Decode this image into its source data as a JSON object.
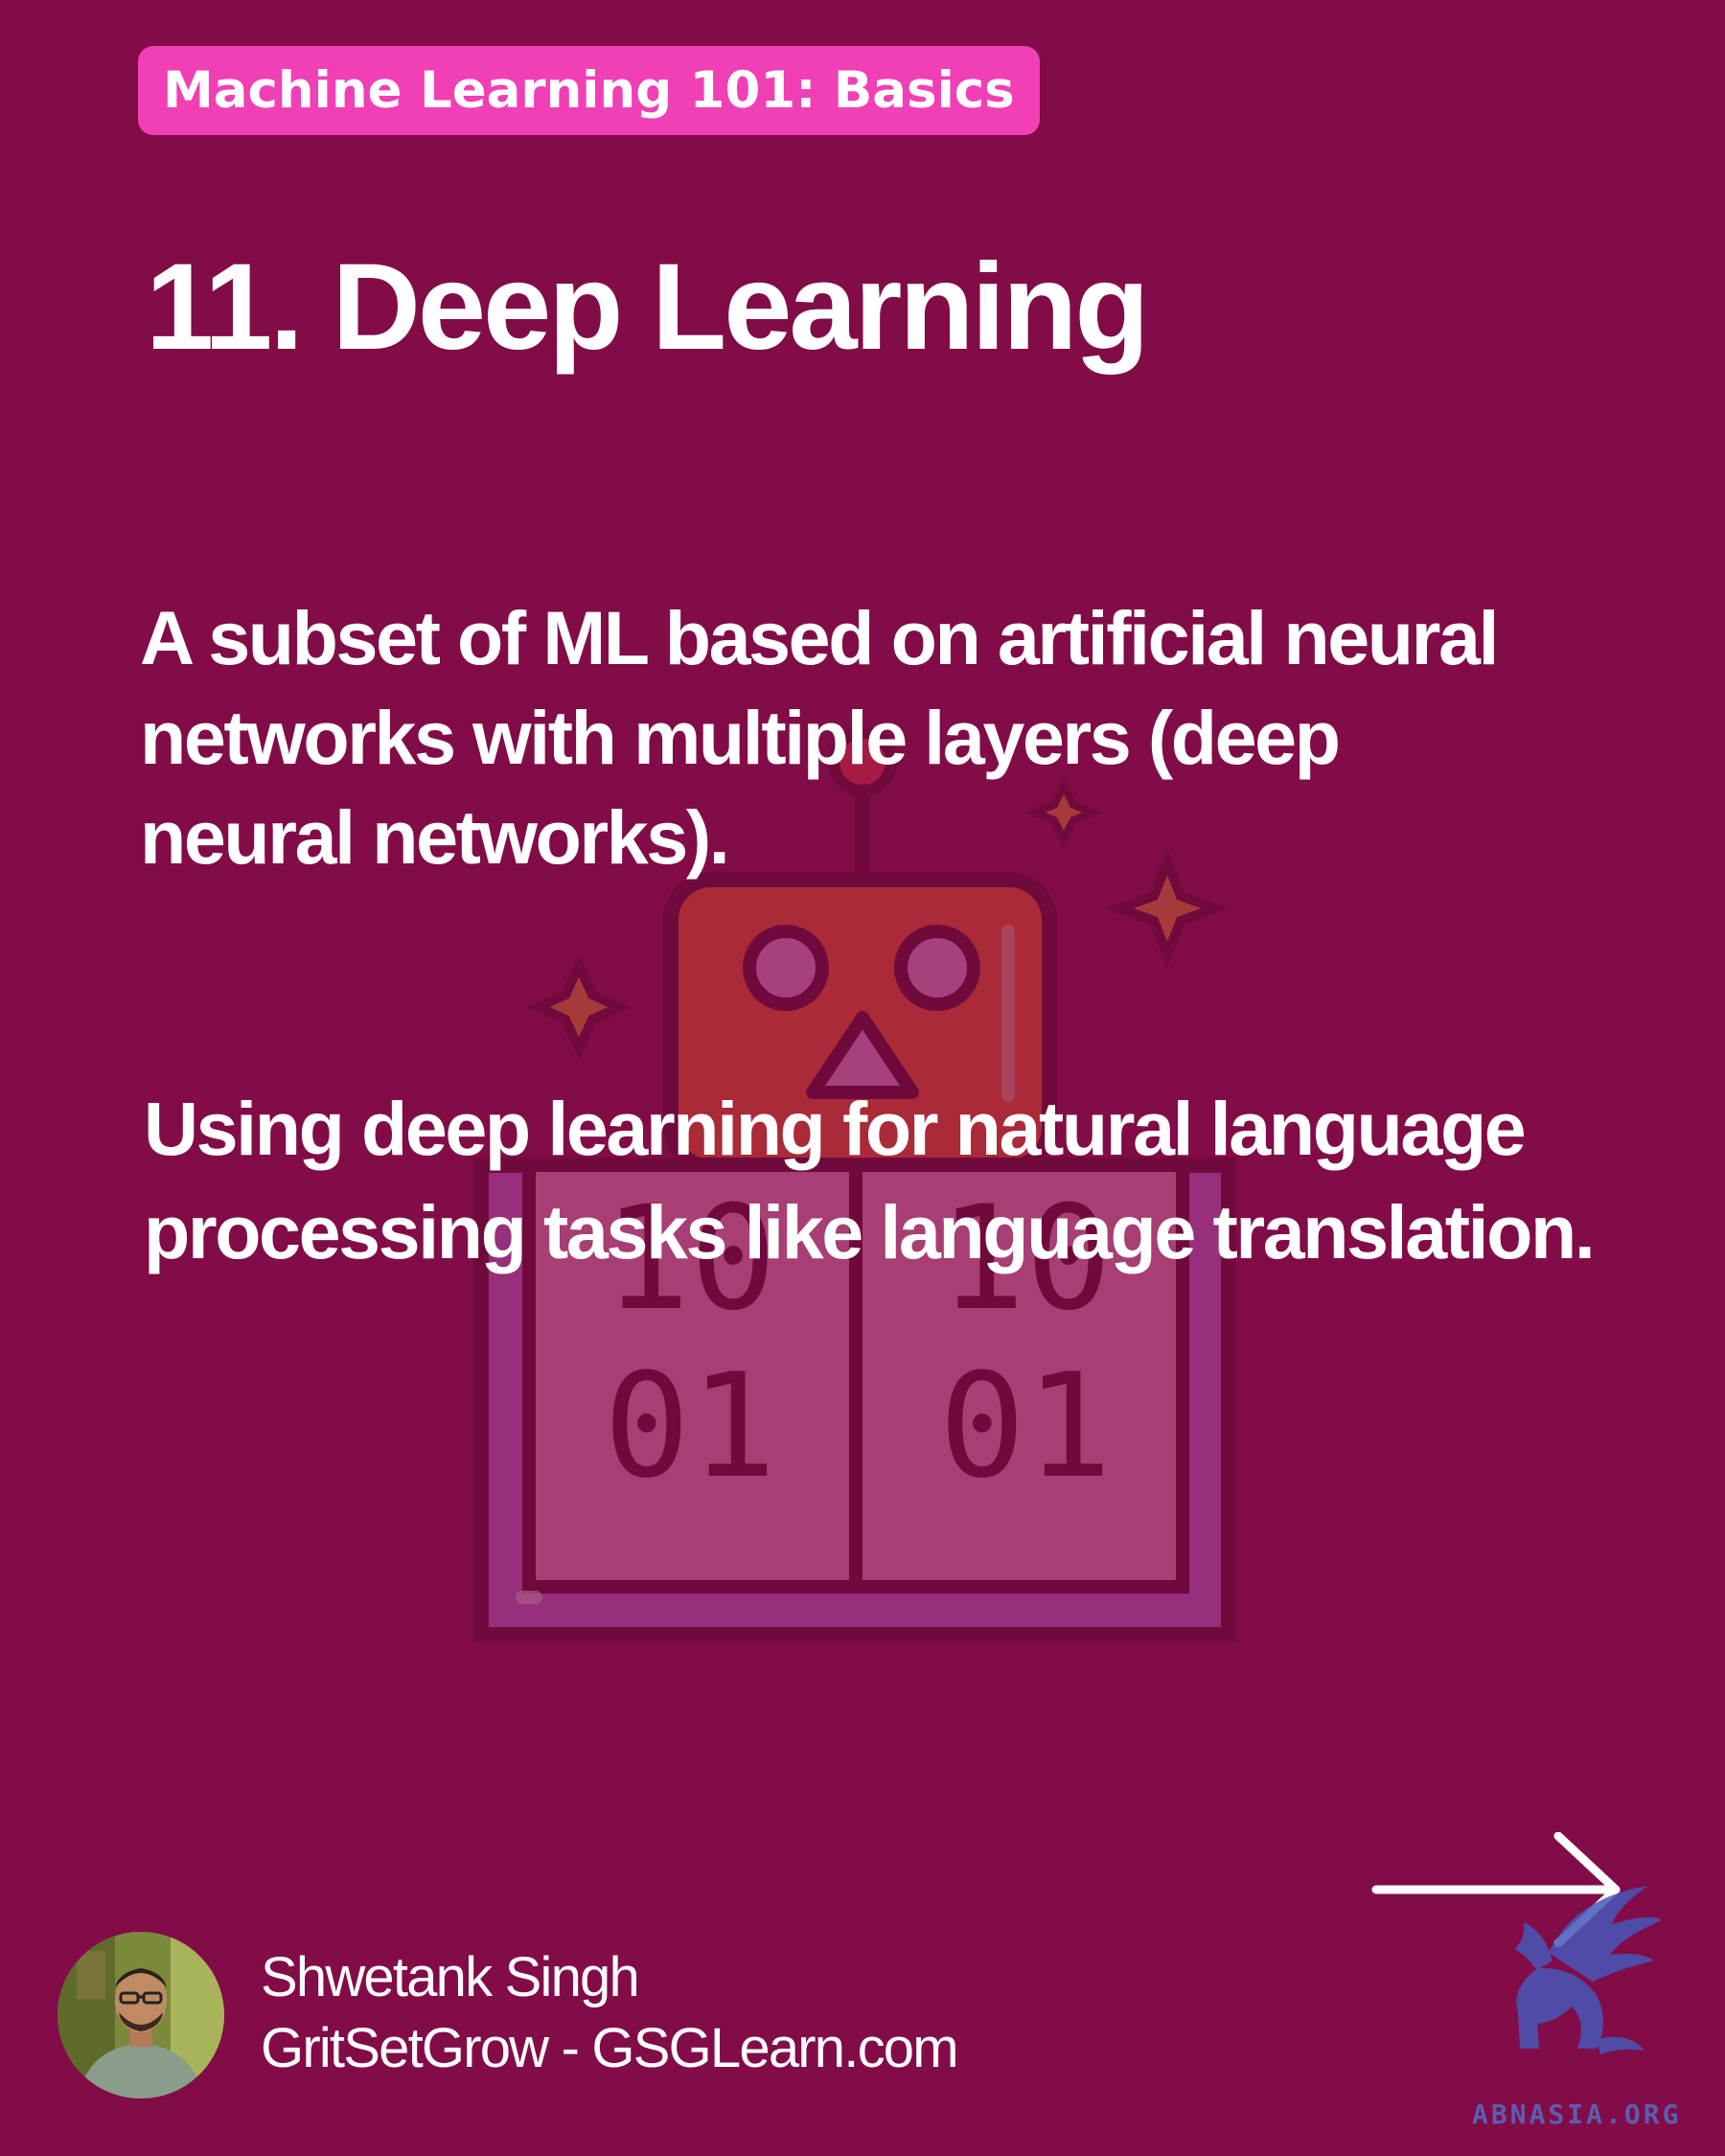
{
  "header": {
    "series_label": "Machine Learning 101: Basics",
    "title": "11. Deep Learning"
  },
  "content": {
    "definition_lines": [
      "A subset of ML based on artificial neural",
      "networks with multiple layers (deep",
      "neural networks)."
    ],
    "example_lines": [
      "Using deep learning for natural language",
      "processing tasks like language translation."
    ]
  },
  "illustration": {
    "icon": "robot-binary-icon",
    "top_left_digits": "10",
    "top_right_digits": "10",
    "bottom_left_digits": "01",
    "bottom_right_digits": "01"
  },
  "footer": {
    "author_name": "Shwetank Singh",
    "author_site": "GritSetGrow - GSGLearn.com",
    "next_icon": "arrow-right-icon",
    "watermark_text": "ABNASIA.ORG"
  },
  "colors": {
    "background": "#820c47",
    "badge": "#f13fb5",
    "text": "#ffffff",
    "watermark": "#5667bd"
  }
}
